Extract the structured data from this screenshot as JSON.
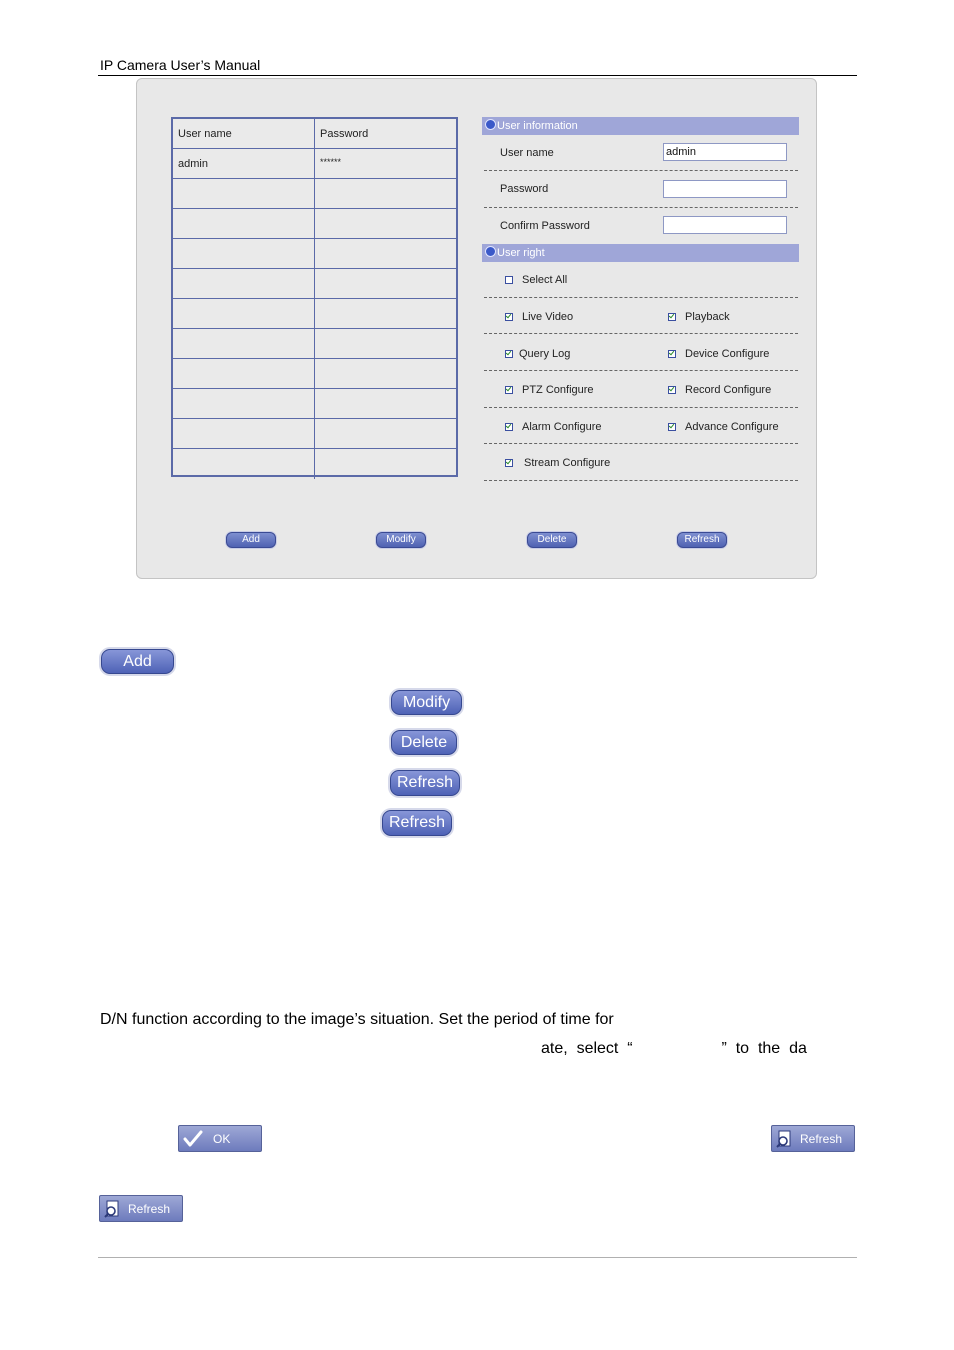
{
  "header": {
    "title": "IP Camera User’s Manual"
  },
  "user_table": {
    "col_user": "User name",
    "col_password": "Password",
    "rows": [
      {
        "user": "admin",
        "password": "******"
      }
    ]
  },
  "user_info": {
    "section_title": "User information",
    "username_label": "User name",
    "username_value": "admin",
    "password_label": "Password",
    "confirm_label": "Confirm Password"
  },
  "user_right": {
    "section_title": "User right",
    "select_all": "Select All",
    "perms": {
      "live_video": "Live Video",
      "playback": "Playback",
      "query_log": "Query Log",
      "device_configure": "Device Configure",
      "ptz_configure": "PTZ Configure",
      "record_configure": "Record Configure",
      "alarm_configure": "Alarm Configure",
      "advance_configure": "Advance Configure",
      "stream_configure": "Stream Configure"
    }
  },
  "panel_buttons": {
    "add": "Add",
    "modify": "Modify",
    "delete": "Delete",
    "refresh": "Refresh"
  },
  "big_buttons": {
    "add": "Add",
    "modify": "Modify",
    "delete": "Delete",
    "refresh_1": "Refresh",
    "refresh_2": "Refresh"
  },
  "body": {
    "line1": "D/N function according to the image’s situation. Set the period of time for",
    "line2": "ate,  select  “                    ”  to  the  da"
  },
  "toolbar_buttons": {
    "ok": "OK",
    "refresh_right": "Refresh",
    "refresh_bottom": "Refresh"
  }
}
